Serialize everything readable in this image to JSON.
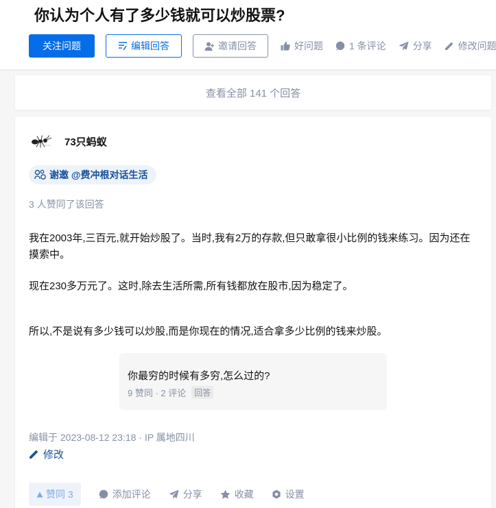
{
  "question": {
    "title": "你认为个人有了多少钱就可以炒股票?",
    "follow_label": "关注问题",
    "edit_answer_label": "编辑回答",
    "invite_label": "邀请回答",
    "good_question_label": "好问题",
    "comments_label": "1 条评论",
    "share_label": "分享",
    "modify_question_label": "修改问题"
  },
  "view_all": {
    "label": "查看全部 141 个回答"
  },
  "answer": {
    "author": "73只蚂蚁",
    "thanks": "谢邀 @费冲根对话生活",
    "votes_text": "3 人赞同了该回答",
    "paragraphs": [
      "我在2003年,三百元,就开始炒股了。当时,我有2万的存款,但只敢拿很小比例的钱来练习。因为还在摸索中。",
      "现在230多万元了。这时,除去生活所需,所有钱都放在股市,因为稳定了。",
      "所以,不是说有多少钱可以炒股,而是你现在的情况,适合拿多少比例的钱来炒股。"
    ],
    "related": {
      "title": "你最穷的时候有多穷,怎么过的?",
      "meta": "9 赞同 · 2 评论",
      "tag": "回答"
    },
    "edited": "编辑于 2023-08-12 23:18 · IP 属地四川",
    "modify_label": "修改",
    "footer": {
      "vote_label": "赞同 3",
      "comment_label": "添加评论",
      "share_label": "分享",
      "collect_label": "收藏",
      "settings_label": "设置"
    }
  },
  "colors": {
    "primary": "#056de8",
    "link": "#175199",
    "muted": "#8590a6"
  }
}
